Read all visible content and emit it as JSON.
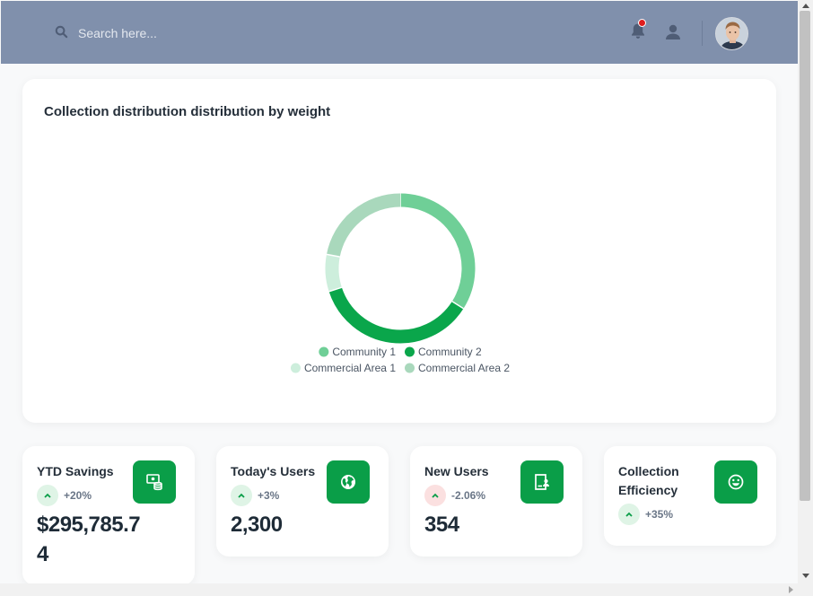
{
  "search": {
    "placeholder": "Search here..."
  },
  "header": {
    "bell_icon": "bell-icon",
    "user_icon": "user-icon",
    "avatar": "user-avatar"
  },
  "chart_card": {
    "title": "Collection distribution distribution by weight"
  },
  "chart_data": {
    "type": "pie",
    "title": "Collection distribution distribution by weight",
    "categories": [
      "Community 1",
      "Community 2",
      "Commercial Area 1",
      "Commercial Area 2"
    ],
    "values": [
      34,
      36,
      8,
      22
    ],
    "colors": [
      "#6fcf97",
      "#0aa64b",
      "#cdeedc",
      "#a9d8bc"
    ],
    "donut": true,
    "legend_placement": "bottom"
  },
  "stats": [
    {
      "title": "YTD Savings",
      "trend": "+20%",
      "direction": "up",
      "value": "$295,785.74",
      "icon": "cash-stack-icon"
    },
    {
      "title": "Today's Users",
      "trend": "+3%",
      "direction": "up",
      "value": "2,300",
      "icon": "globe-icon"
    },
    {
      "title": "New Users",
      "trend": "-2.06%",
      "direction": "down",
      "value": "354",
      "icon": "user-card-icon"
    },
    {
      "title": "Collection Efficiency",
      "trend": "+35%",
      "direction": "up",
      "value": "",
      "icon": "smiley-icon"
    }
  ],
  "colors": {
    "topbar": "#8090ac",
    "accent": "#0a9e48",
    "up": "#0a9e48",
    "down": "#e45b5b"
  }
}
